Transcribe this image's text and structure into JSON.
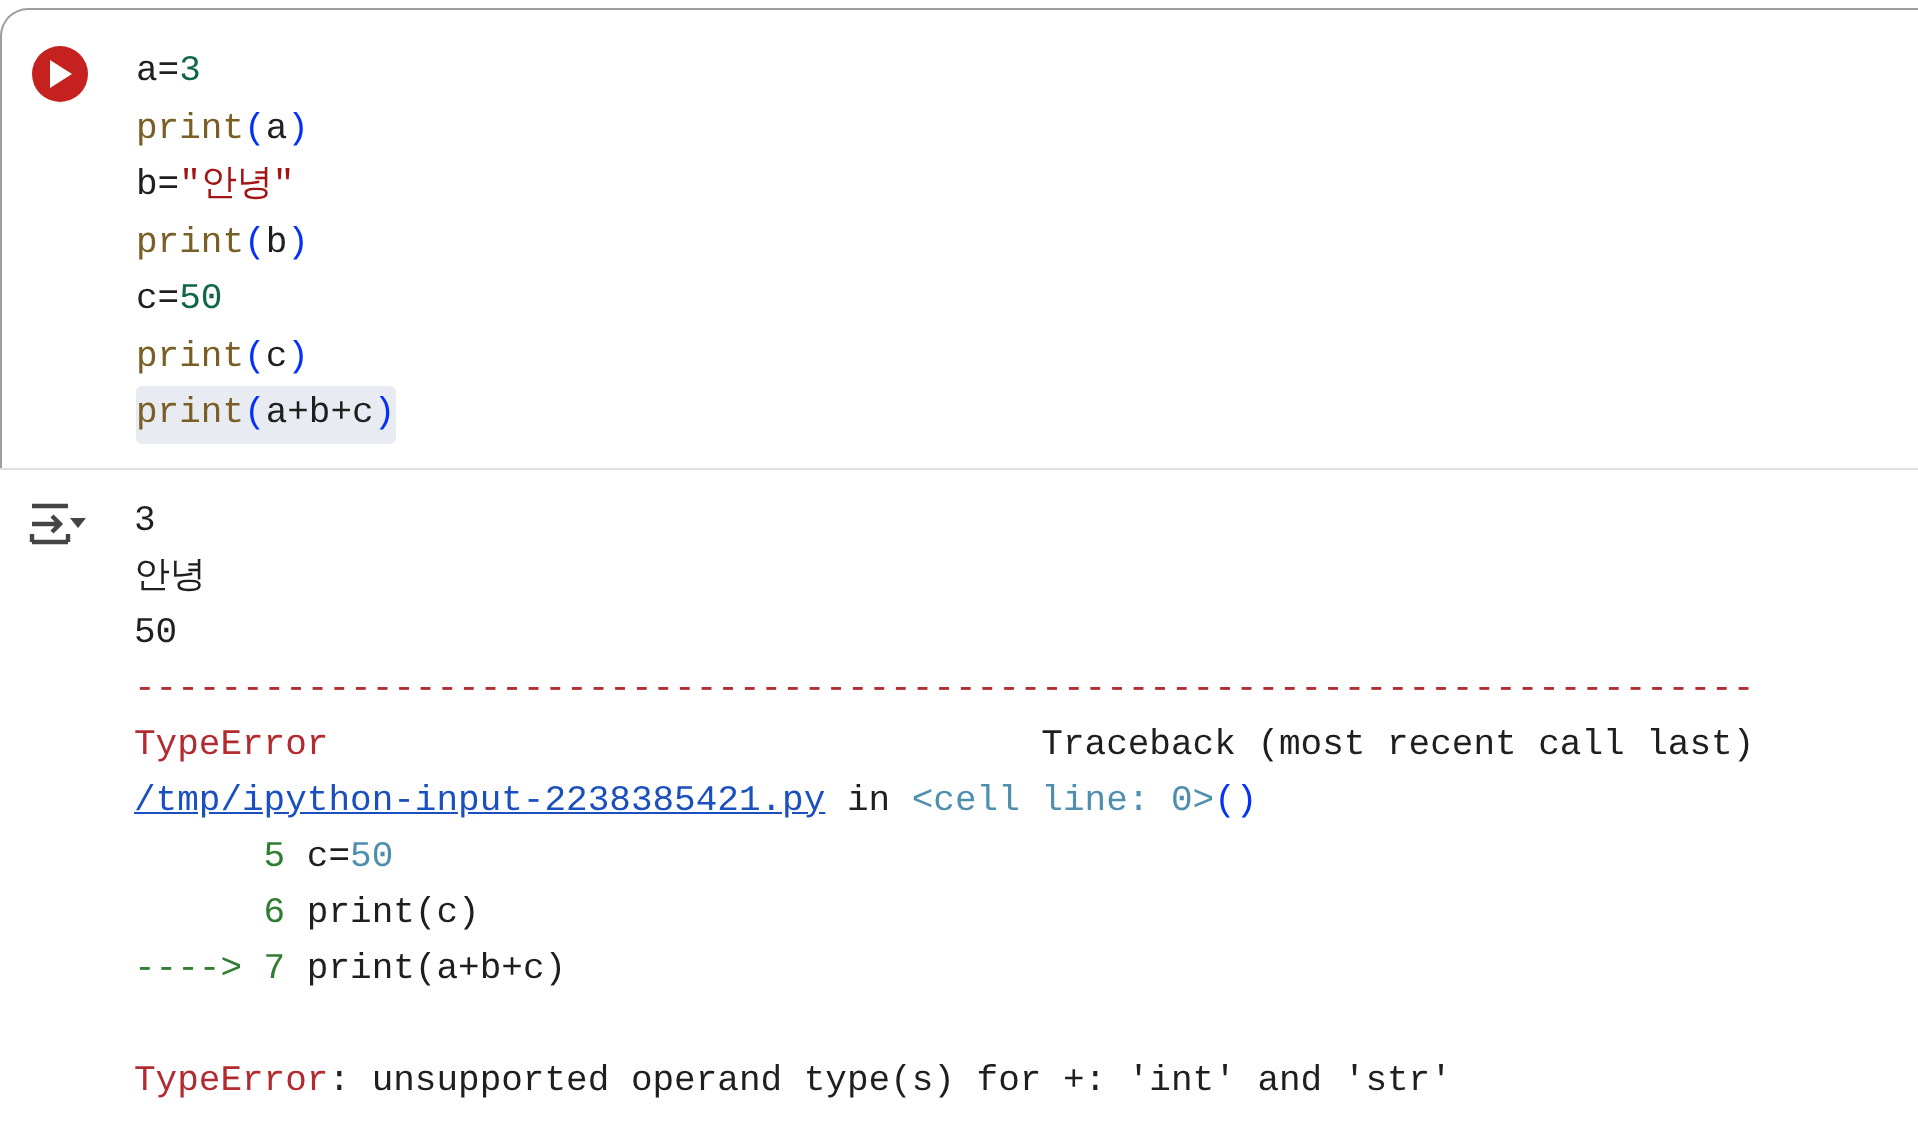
{
  "code_cell": {
    "code_lines": [
      {
        "highlighted": false,
        "tokens": [
          {
            "text": "a=",
            "kind": "plain"
          },
          {
            "text": "3",
            "kind": "number"
          }
        ]
      },
      {
        "highlighted": false,
        "tokens": [
          {
            "text": "print",
            "kind": "builtin"
          },
          {
            "text": "(",
            "kind": "paren"
          },
          {
            "text": "a",
            "kind": "plain"
          },
          {
            "text": ")",
            "kind": "paren"
          }
        ]
      },
      {
        "highlighted": false,
        "tokens": [
          {
            "text": "b=",
            "kind": "plain"
          },
          {
            "text": "\"안녕\"",
            "kind": "string"
          }
        ]
      },
      {
        "highlighted": false,
        "tokens": [
          {
            "text": "print",
            "kind": "builtin"
          },
          {
            "text": "(",
            "kind": "paren"
          },
          {
            "text": "b",
            "kind": "plain"
          },
          {
            "text": ")",
            "kind": "paren"
          }
        ]
      },
      {
        "highlighted": false,
        "tokens": [
          {
            "text": "c=",
            "kind": "plain"
          },
          {
            "text": "50",
            "kind": "number"
          }
        ]
      },
      {
        "highlighted": false,
        "tokens": [
          {
            "text": "print",
            "kind": "builtin"
          },
          {
            "text": "(",
            "kind": "paren"
          },
          {
            "text": "c",
            "kind": "plain"
          },
          {
            "text": ")",
            "kind": "paren"
          }
        ]
      },
      {
        "highlighted": true,
        "tokens": [
          {
            "text": "print",
            "kind": "builtin"
          },
          {
            "text": "(",
            "kind": "paren"
          },
          {
            "text": "a+b+c",
            "kind": "plain"
          },
          {
            "text": ")",
            "kind": "paren"
          }
        ]
      }
    ],
    "output_lines": [
      {
        "tokens": [
          {
            "text": "3",
            "kind": "plain"
          }
        ]
      },
      {
        "tokens": [
          {
            "text": "안녕",
            "kind": "plain"
          }
        ]
      },
      {
        "tokens": [
          {
            "text": "50",
            "kind": "plain"
          }
        ]
      },
      {
        "tokens": [
          {
            "text": "---------------------------------------------------------------------------",
            "kind": "error"
          }
        ]
      },
      {
        "tokens": [
          {
            "text": "TypeError",
            "kind": "error"
          },
          {
            "text": "                                 Traceback (most recent call last)",
            "kind": "plain"
          }
        ]
      },
      {
        "tokens": [
          {
            "text": "/tmp/ipython-input-2238385421.py",
            "kind": "link"
          },
          {
            "text": " in ",
            "kind": "plain"
          },
          {
            "text": "<cell line: 0>",
            "kind": "dim"
          },
          {
            "text": "()",
            "kind": "paren"
          }
        ]
      },
      {
        "tokens": [
          {
            "text": "      5",
            "kind": "lineno"
          },
          {
            "text": " c=",
            "kind": "plain"
          },
          {
            "text": "50",
            "kind": "dim"
          }
        ]
      },
      {
        "tokens": [
          {
            "text": "      6",
            "kind": "lineno"
          },
          {
            "text": " print(c)",
            "kind": "plain"
          }
        ]
      },
      {
        "tokens": [
          {
            "text": "----> 7",
            "kind": "lineno"
          },
          {
            "text": " print(a+b+c)",
            "kind": "plain"
          }
        ]
      },
      {
        "kind": "blank"
      },
      {
        "tokens": [
          {
            "text": "TypeError",
            "kind": "error"
          },
          {
            "text": ": unsupported operand type(s) for +: 'int' and 'str'",
            "kind": "plain"
          }
        ]
      }
    ]
  }
}
